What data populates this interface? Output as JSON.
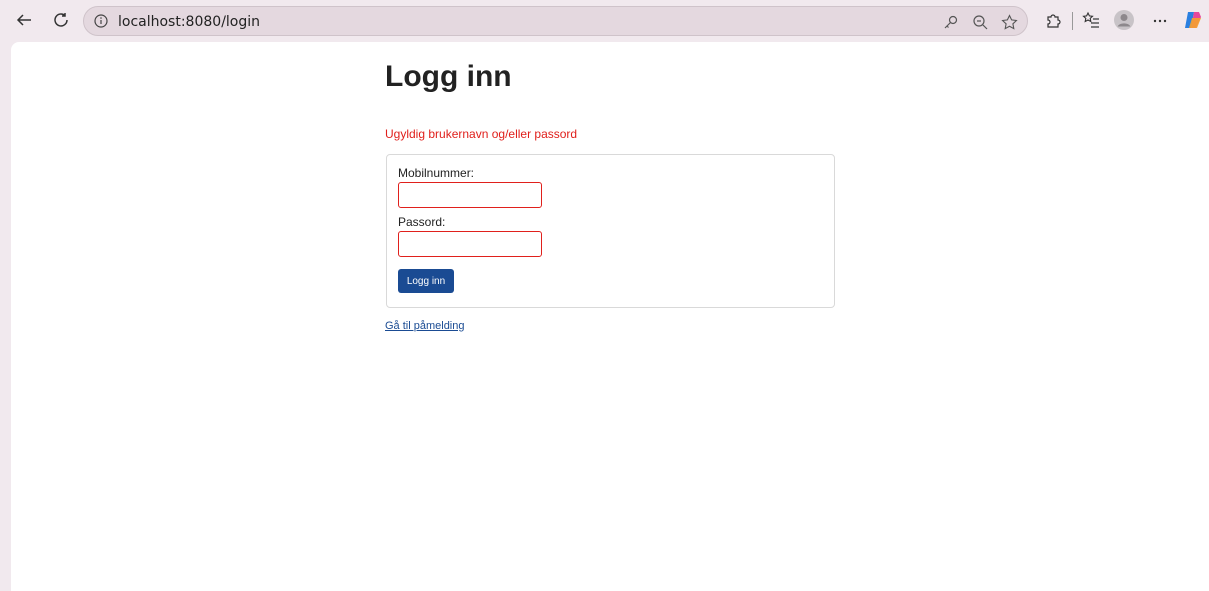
{
  "browser": {
    "url": "localhost:8080/login"
  },
  "page": {
    "title": "Logg inn",
    "error": "Ugyldig brukernavn og/eller passord",
    "form": {
      "phone_label": "Mobilnummer:",
      "phone_value": "",
      "password_label": "Passord:",
      "password_value": "",
      "submit_label": "Logg inn"
    },
    "signup_link": "Gå til påmelding"
  },
  "colors": {
    "error": "#e0201c",
    "primary": "#1a4b93",
    "chrome_bg": "#f1e9ee"
  },
  "icons": {
    "back": "back-arrow-icon",
    "reload": "reload-icon",
    "info": "info-icon",
    "password_key": "key-icon",
    "zoom": "zoom-out-icon",
    "favorite": "star-icon",
    "extensions": "extensions-icon",
    "favorites_list": "favorites-list-icon",
    "profile": "avatar",
    "more": "more-icon",
    "copilot": "copilot-icon"
  }
}
